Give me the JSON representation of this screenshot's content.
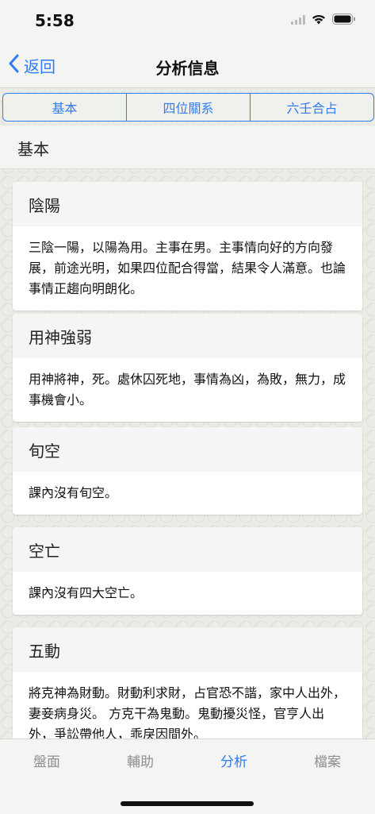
{
  "status": {
    "time": "5:58"
  },
  "nav": {
    "back_label": "返回",
    "title": "分析信息"
  },
  "segments": [
    {
      "label": "基本"
    },
    {
      "label": "四位關系"
    },
    {
      "label": "六壬合占"
    }
  ],
  "section": {
    "title": "基本"
  },
  "cards": [
    {
      "title": "陰陽",
      "body": "三陰一陽，以陽為用。主事在男。主事情向好的方向發展，前途光明，如果四位配合得當，結果令人滿意。也論事情正趨向明朗化。"
    },
    {
      "title": "用神強弱",
      "body": "用神將神，死。處休囚死地，事情為凶，為敗，無力，成事機會小。"
    },
    {
      "title": "旬空",
      "body": "課內沒有旬空。"
    },
    {
      "title": "空亡",
      "body": "課內沒有四大空亡。"
    },
    {
      "title": "五動",
      "body": "將克神為財動。財動利求財，占官恐不諧，家中人出外，妻妾病身災。 方克干為鬼動。鬼動擾災怪，官亨人出外，爭訟帶他人，乖戾因間外。"
    }
  ],
  "tabs": [
    {
      "label": "盤面"
    },
    {
      "label": "輔助"
    },
    {
      "label": "分析"
    },
    {
      "label": "檔案"
    }
  ],
  "active_tab": "分析",
  "colors": {
    "accent": "#2f7cf6",
    "inactive": "#8e8e93"
  }
}
